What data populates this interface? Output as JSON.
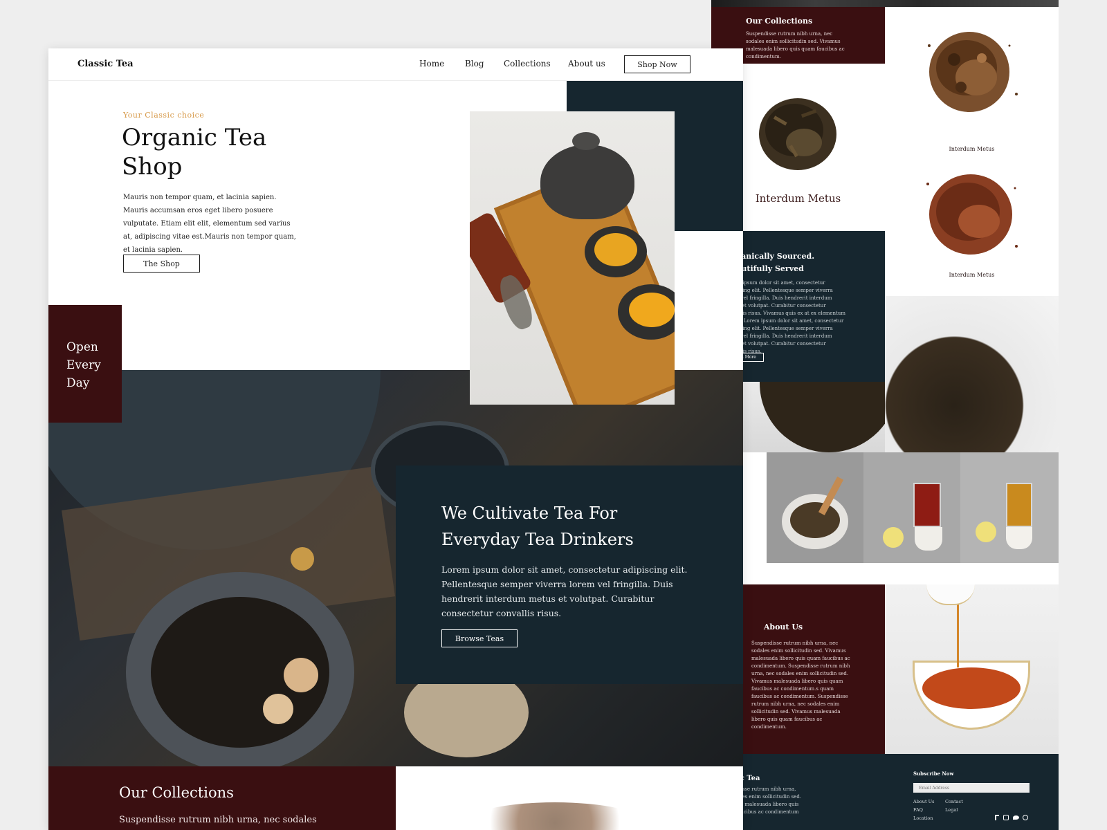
{
  "back_page": {
    "collections_title": "Our Collections",
    "collections_text": "Suspendisse rutrum nibh urna, nec sodales enim sollicitudin sed. Vivamus malesuada libero quis quam faucibus ac condimentum.",
    "product_big_label": "Interdum Metus",
    "product_a_label": "Interdum Metus",
    "product_b_label": "Interdum Metus",
    "sourced_line1": "Organically Sourced.",
    "sourced_line2": "Beautifully Served",
    "sourced_text": "Lorem ipsum dolor sit amet, consectetur adipiscing elit. Pellentesque semper viverra lorem vel fringilla. Duis hendrerit interdum metus et volutpat. Curabitur consectetur convallis risus. Vivamus quis ex at ex elementum mattis. Lorem ipsum dolor sit amet, consectetur adipiscing elit. Pellentesque semper viverra lorem vel fringilla. Duis hendrerit interdum metus et volutpat. Curabitur consectetur convallis risus.",
    "read_more": "Read More",
    "about_title": "About Us",
    "about_text": "Suspendisse rutrum nibh urna, nec sodales enim sollicitudin sed. Vivamus malesuada libero quis quam faucibus ac condimentum. Suspendisse rutrum nibh urna, nec sodales enim sollicitudin sed. Vivamus malesuada libero quis quam faucibus ac condimentum.s quam faucibus ac condimentum. Suspendisse rutrum nibh urna, nec sodales enim sollicitudin sed. Vivamus malesuada libero quis quam faucibus ac condimentum.",
    "footer_brand": "ic Tea",
    "footer_text": "disse rutrum nibh urna, ales enim sollicitudin sed. us malesuada libero quis aucibus ac condimentum",
    "subscribe_title": "Subscribe Now",
    "email_placeholder": "Email Address",
    "footer_links": [
      "About Us",
      "FAQ",
      "Location"
    ],
    "footer_links2": [
      "Contact",
      "Legal"
    ],
    "social_icons": [
      "facebook-icon",
      "instagram-icon",
      "twitter-icon",
      "dribbble-icon"
    ]
  },
  "nav": {
    "brand": "Classic Tea",
    "links": [
      "Home",
      "Blog",
      "Collections",
      "About us"
    ],
    "cta": "Shop Now"
  },
  "hero": {
    "eyebrow": "Your Classic choice",
    "title_line1": "Organic Tea",
    "title_line2": "Shop",
    "text": "Mauris non tempor quam, et lacinia sapien. Mauris accumsan eros eget libero posuere vulputate. Etiam elit elit, elementum sed varius at, adipiscing vitae est.Mauris non tempor quam, et lacinia sapien.",
    "button": "The Shop"
  },
  "open": {
    "line1": "Open",
    "line2": "Every",
    "line3": "Day"
  },
  "cultivate": {
    "title_line1": "We Cultivate Tea For",
    "title_line2": "Everyday Tea Drinkers",
    "text": "Lorem ipsum dolor sit amet, consectetur adipiscing elit. Pellentesque semper viverra lorem vel fringilla. Duis hendrerit interdum metus et volutpat. Curabitur consectetur convallis risus.",
    "button": "Browse Teas"
  },
  "collections": {
    "title": "Our Collections",
    "text": "Suspendisse rutrum nibh urna, nec sodales"
  },
  "colors": {
    "maroon": "#3a0f11",
    "navy": "#16262f",
    "accent": "#d79a4a",
    "background": "#eeeeee"
  }
}
